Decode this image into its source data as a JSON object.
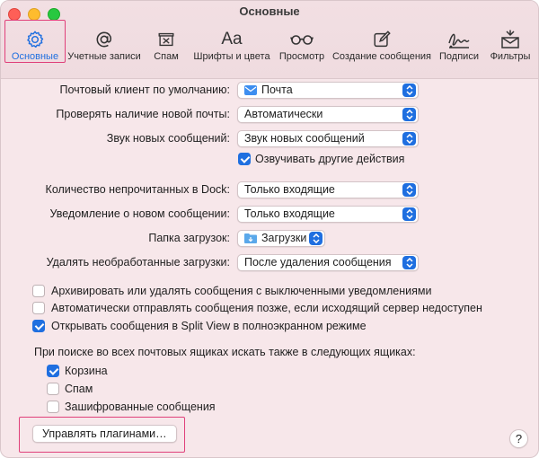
{
  "window": {
    "title": "Основные"
  },
  "toolbar": [
    {
      "label": "Основные",
      "icon": "gear-icon"
    },
    {
      "label": "Учетные записи",
      "icon": "at-sign-icon"
    },
    {
      "label": "Спам",
      "icon": "junk-mail-icon"
    },
    {
      "label": "Шрифты и цвета",
      "icon": "fonts-icon"
    },
    {
      "label": "Просмотр",
      "icon": "glasses-icon"
    },
    {
      "label": "Создание сообщения",
      "icon": "compose-icon"
    },
    {
      "label": "Подписи",
      "icon": "signature-icon"
    },
    {
      "label": "Фильтры",
      "icon": "rules-icon"
    }
  ],
  "settings": {
    "default_client": {
      "label": "Почтовый клиент по умолчанию:",
      "value": "Почта"
    },
    "check_mail": {
      "label": "Проверять наличие новой почты:",
      "value": "Автоматически"
    },
    "new_mail_sound": {
      "label": "Звук новых сообщений:",
      "value": "Звук новых сообщений"
    },
    "play_other_sounds": {
      "label": "Озвучивать другие действия",
      "checked": true
    },
    "dock_unread": {
      "label": "Количество непрочитанных в Dock:",
      "value": "Только входящие"
    },
    "new_message_notification": {
      "label": "Уведомление о новом сообщении:",
      "value": "Только входящие"
    },
    "downloads_folder": {
      "label": "Папка загрузок:",
      "value": "Загрузки"
    },
    "remove_downloads": {
      "label": "Удалять необработанные загрузки:",
      "value": "После удаления сообщения"
    },
    "archive_muted": {
      "label": "Архивировать или удалять сообщения с выключенными уведомлениями",
      "checked": false
    },
    "send_later": {
      "label": "Автоматически отправлять сообщения позже, если исходящий сервер недоступен",
      "checked": false
    },
    "split_view": {
      "label": "Открывать сообщения в Split View в полноэкранном режиме",
      "checked": true
    }
  },
  "search": {
    "heading": "При поиске во всех почтовых ящиках искать также в следующих ящиках:",
    "trash": {
      "label": "Корзина",
      "checked": true
    },
    "junk": {
      "label": "Спам",
      "checked": false
    },
    "encrypted": {
      "label": "Зашифрованные сообщения",
      "checked": false
    }
  },
  "buttons": {
    "manage_plugins": "Управлять плагинами…",
    "help": "?"
  },
  "colors": {
    "accent": "#1f6fe0",
    "highlight": "#e0407a",
    "background": "#f7e7ea"
  }
}
